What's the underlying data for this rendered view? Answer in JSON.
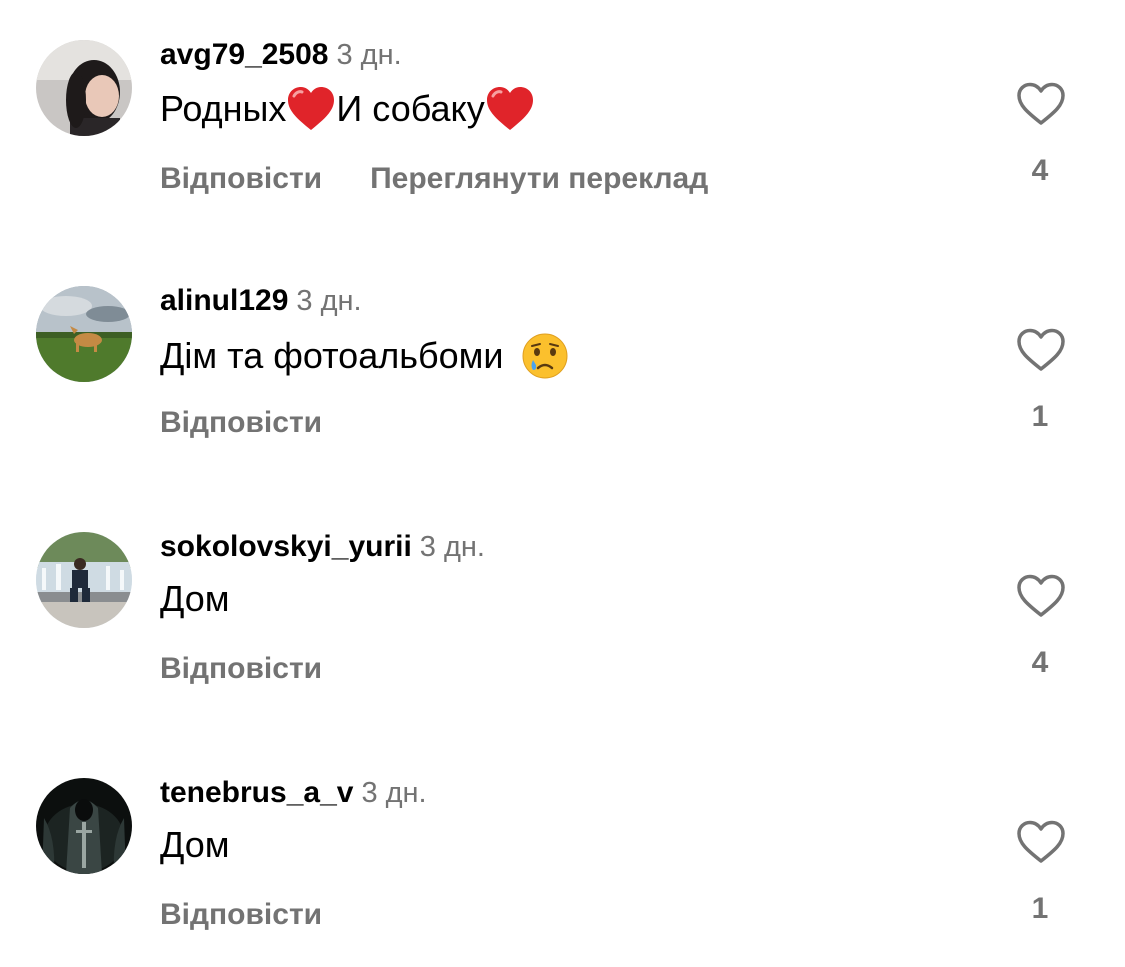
{
  "comments": [
    {
      "username": "avg79_2508",
      "time": "3 дн.",
      "text_part1": "Родных",
      "text_part2": "И собаку",
      "reply": "Відповісти",
      "translate": "Переглянути переклад",
      "likes": "4"
    },
    {
      "username": "alinul129",
      "time": "3 дн.",
      "text": "Дім та фотоальбоми",
      "emoji": "crying-face",
      "reply": "Відповісти",
      "likes": "1"
    },
    {
      "username": "sokolovskyi_yurii",
      "time": "3 дн.",
      "text": "Дом",
      "reply": "Відповісти",
      "likes": "4"
    },
    {
      "username": "tenebrus_a_v",
      "time": "3 дн.",
      "text": "Дом",
      "reply": "Відповісти",
      "likes": "1"
    }
  ],
  "icons": {
    "like": "heart-outline-icon",
    "emoji_heart": "red-heart",
    "emoji_tear": "crying-face"
  },
  "colors": {
    "secondary_text": "#737373",
    "primary_text": "#000000",
    "background": "#ffffff"
  }
}
